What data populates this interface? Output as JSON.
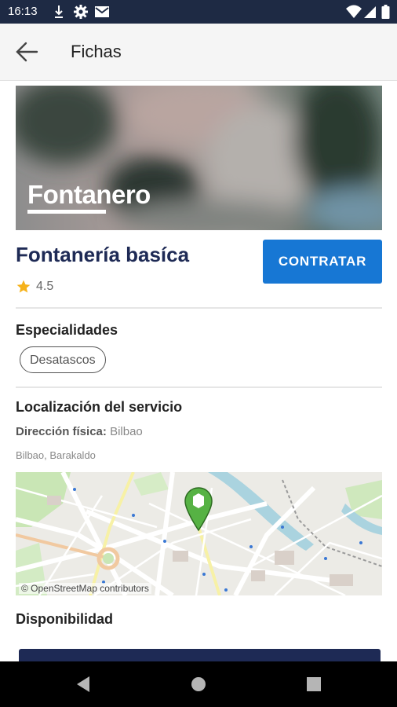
{
  "status_bar": {
    "time": "16:13",
    "left_icons": [
      "download-icon",
      "settings-icon",
      "mail-icon"
    ],
    "right_icons": [
      "wifi-icon",
      "signal-icon",
      "battery-icon"
    ]
  },
  "appbar": {
    "back_icon": "arrow-left-icon",
    "title": "Fichas"
  },
  "hero": {
    "label": "Fontanero"
  },
  "service": {
    "title": "Fontanería basíca",
    "rating": "4.5",
    "rating_icon": "star-icon",
    "cta_label": "CONTRATAR"
  },
  "specialties": {
    "heading": "Especialidades",
    "items": [
      "Desatascos"
    ]
  },
  "location": {
    "heading": "Localización del servicio",
    "address_label": "Dirección física:",
    "address_value": "Bilbao",
    "address_sub": "Bilbao, Barakaldo",
    "map_attribution": "© OpenStreetMap contributors",
    "marker_icon": "map-pin-icon"
  },
  "availability": {
    "heading": "Disponibilidad"
  },
  "nav_bar": {
    "icons": [
      "back-triangle-icon",
      "home-circle-icon",
      "recents-square-icon"
    ]
  },
  "colors": {
    "status_bar": "#1e2a44",
    "title_navy": "#1e2a55",
    "button_blue": "#1777d4",
    "star": "#f6b21a",
    "marker_green": "#56b244"
  }
}
